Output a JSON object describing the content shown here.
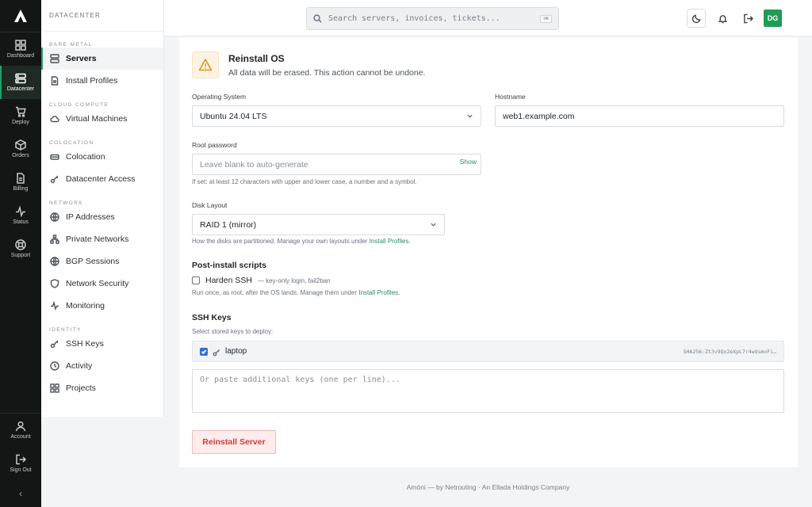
{
  "rail": {
    "logo": "app-logo",
    "items": [
      {
        "label": "Dashboard",
        "icon": "grid-icon"
      },
      {
        "label": "Datacenter",
        "icon": "server-icon",
        "active": true
      },
      {
        "label": "Deploy",
        "icon": "cart-icon"
      },
      {
        "label": "Orders",
        "icon": "box-icon"
      },
      {
        "label": "Billing",
        "icon": "document-icon"
      },
      {
        "label": "Status",
        "icon": "activity-icon"
      },
      {
        "label": "Support",
        "icon": "lifebuoy-icon"
      }
    ],
    "bottom": [
      {
        "label": "Account",
        "icon": "user-icon"
      },
      {
        "label": "Sign Out",
        "icon": "sign-out-icon"
      }
    ],
    "collapse": "‹"
  },
  "sidebar": {
    "title": "DATACENTER",
    "sections": [
      {
        "label": "BARE METAL",
        "items": [
          "Servers",
          "Install Profiles"
        ]
      },
      {
        "label": "CLOUD COMPUTE",
        "items": [
          "Virtual Machines"
        ]
      },
      {
        "label": "COLOCATION",
        "items": [
          "Colocation",
          "Datacenter Access"
        ]
      },
      {
        "label": "NETWORK",
        "items": [
          "IP Addresses",
          "Private Networks",
          "BGP Sessions",
          "Network Security",
          "Monitoring"
        ]
      },
      {
        "label": "IDENTITY",
        "items": [
          "SSH Keys",
          "Activity",
          "Projects"
        ]
      }
    ],
    "active_item": "Servers"
  },
  "topbar": {
    "search_placeholder": "Search servers, invoices, tickets...",
    "search_shortcut": "⌘K",
    "avatar_initials": "DG"
  },
  "form": {
    "title": "Reinstall OS",
    "subtitle": "All data will be erased. This action cannot be undone.",
    "os_label": "Operating System",
    "os_value": "Ubuntu 24.04 LTS",
    "hostname_label": "Hostname",
    "hostname_value": "web1.example.com",
    "password_label": "Root password",
    "password_placeholder": "Leave blank to auto-generate",
    "password_show": "Show",
    "password_help": "If set: at least 12 characters with upper and lower case, a number and a symbol.",
    "disk_label": "Disk Layout",
    "disk_value": "RAID 1 (mirror)",
    "disk_help_prefix": "How the disks are partitioned. Manage your own layouts under",
    "disk_help_link": "Install Profiles",
    "scripts_title": "Post-install scripts",
    "script_name": "Harden SSH",
    "script_note": "— key-only login, fail2ban",
    "script_checked": false,
    "scripts_help_prefix": "Run once, as root, after the OS lands. Manage them under",
    "scripts_help_link": "Install Profiles",
    "ssh_title": "SSH Keys",
    "ssh_sub": "Select stored keys to deploy:",
    "key_name": "laptop",
    "key_checked": true,
    "key_fingerprint": "SHA256:Zt3v9Qx2eXpL7r4wQsmoFi…",
    "paste_placeholder": "Or paste additional keys (one per line)...",
    "submit": "Reinstall Server"
  },
  "footer": "Amóni — by Netrouting · An Ellada Holdings Company",
  "colors": {
    "accent": "#22a06b",
    "danger": "#d33a3a",
    "link": "#2b8a6e",
    "rail_bg": "#121614"
  }
}
